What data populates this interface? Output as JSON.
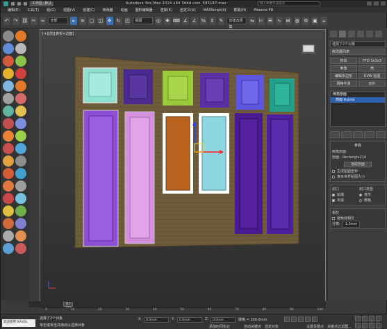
{
  "title": {
    "workspace_label": "工作区: 默认",
    "text": "Autodesk 3ds Max  2014 x64        3ddd.com_595187.max",
    "search_placeholder": "键入关键字或短语"
  },
  "menu": [
    "编辑(E)",
    "工具(T)",
    "组(G)",
    "视图(V)",
    "创建(C)",
    "修改器",
    "动画",
    "图形编辑器",
    "渲染(R)",
    "自定义(U)",
    "MAXScript(X)",
    "帮助(H)",
    "Phoenix FD"
  ],
  "toolbar": {
    "selection_filter": "全部",
    "ref_coord": "视图",
    "named_set": "创建选择集"
  },
  "viewport": {
    "label": "[+][前][真实+边面]"
  },
  "command_panel": {
    "object_name": "选择了2个对象",
    "modifier_list": "修改器列表",
    "buttons": [
      "挤出",
      "FFD 3x3x3",
      "倒角",
      "壳",
      "编辑多边形",
      "UVW 贴图",
      "网格平滑",
      "切片"
    ],
    "stack_top": "倒角剖面",
    "stack_sub": "剖面 Gizmo",
    "params_title": "参数",
    "bevel_profile": "倒角剖面",
    "profile_label": "剖面:",
    "profile_value": "Rectangle214",
    "pick_profile": "拾取剖面",
    "gen_mapping": "生成贴图坐标",
    "real_world": "真实世界贴图大小",
    "capping_title": "封口",
    "capping_start": "始端",
    "capping_end": "末端",
    "cap_type_title": "封口类型",
    "cap_morph": "变形",
    "cap_grid": "栅格",
    "intersect_title": "相交",
    "avoid_self": "避免线相交",
    "separation_label": "分离:",
    "separation_value": "1.0mm"
  },
  "timeline": {
    "frame": "0 / 100",
    "ticks": [
      "0",
      "10",
      "20",
      "30",
      "40",
      "50",
      "60",
      "70",
      "80",
      "90",
      "100"
    ]
  },
  "status": {
    "welcome": "欢迎使用 MAXSc",
    "selected": "选择了2个对象",
    "hint": "单击或单击并拖动以选择对象",
    "x_label": "X:",
    "x_value": "0.0mm",
    "y_label": "Y:",
    "y_value": "0.0mm",
    "z_label": "Z:",
    "z_value": "0.0mm",
    "grid": "栅格 = 100.0mm",
    "add_time_tag": "添加时间标记",
    "auto_key": "自动关键点",
    "selected_obj": "选定对象",
    "set_key": "设置关键点",
    "key_filters": "关键点过滤器..."
  },
  "colors": {
    "panels": [
      "#8fe0cf",
      "#4b2a8f",
      "#9bc93c",
      "#5a2fa5",
      "#5d56e0",
      "#24a08a"
    ],
    "doors": [
      "#8e4fd6",
      "#d78fe0",
      "#b8621e",
      "#8ed7e0",
      "#4a1a92",
      "#4e20a0"
    ],
    "frame": "#6b5a3a"
  }
}
